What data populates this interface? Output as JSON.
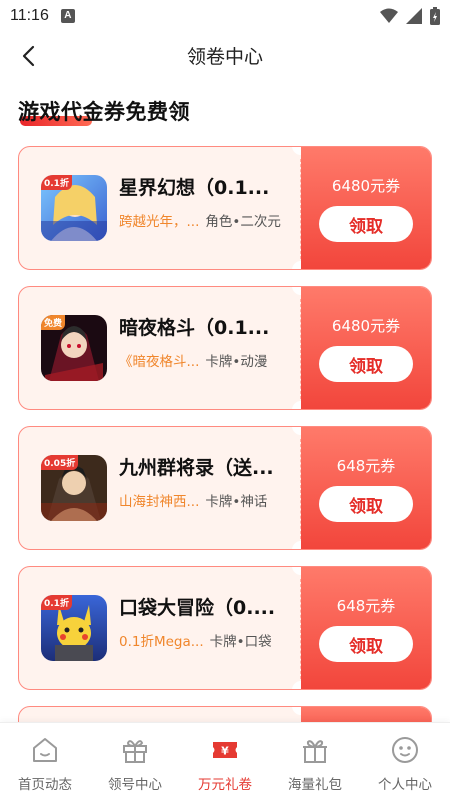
{
  "status": {
    "time": "11:16",
    "a_badge": "A"
  },
  "header": {
    "title": "领卷中心"
  },
  "section": {
    "title": "游戏代金券免费领"
  },
  "coupons": [
    {
      "name": "星界幻想（0.1...",
      "subtitle": "跨越光年，...",
      "tags": "角色•二次元",
      "value": "6480元券",
      "button": "领取",
      "icon_badge": "0.1折"
    },
    {
      "name": "暗夜格斗（0.1...",
      "subtitle": "《暗夜格斗...",
      "tags": "卡牌•动漫",
      "value": "6480元券",
      "button": "领取",
      "icon_badge": "免费"
    },
    {
      "name": "九州群将录（送...",
      "subtitle": "山海封神西...",
      "tags": "卡牌•神话",
      "value": "648元券",
      "button": "领取",
      "icon_badge": "0.05折"
    },
    {
      "name": "口袋大冒险（0....",
      "subtitle": "0.1折Mega...",
      "tags": "卡牌•口袋",
      "value": "648元券",
      "button": "领取",
      "icon_badge": "0.1折"
    }
  ],
  "nav": [
    {
      "label": "首页动态",
      "icon": "home-icon"
    },
    {
      "label": "领号中心",
      "icon": "gift-icon"
    },
    {
      "label": "万元礼卷",
      "icon": "coupon-icon"
    },
    {
      "label": "海量礼包",
      "icon": "giftbox-icon"
    },
    {
      "label": "个人中心",
      "icon": "profile-icon"
    }
  ],
  "colors": {
    "accent": "#e53a32",
    "coupon_gradient_top": "#ff7a6a",
    "coupon_gradient_bottom": "#f2463c",
    "card_bg": "#fff3ee",
    "subtitle_orange": "#f0862c"
  }
}
